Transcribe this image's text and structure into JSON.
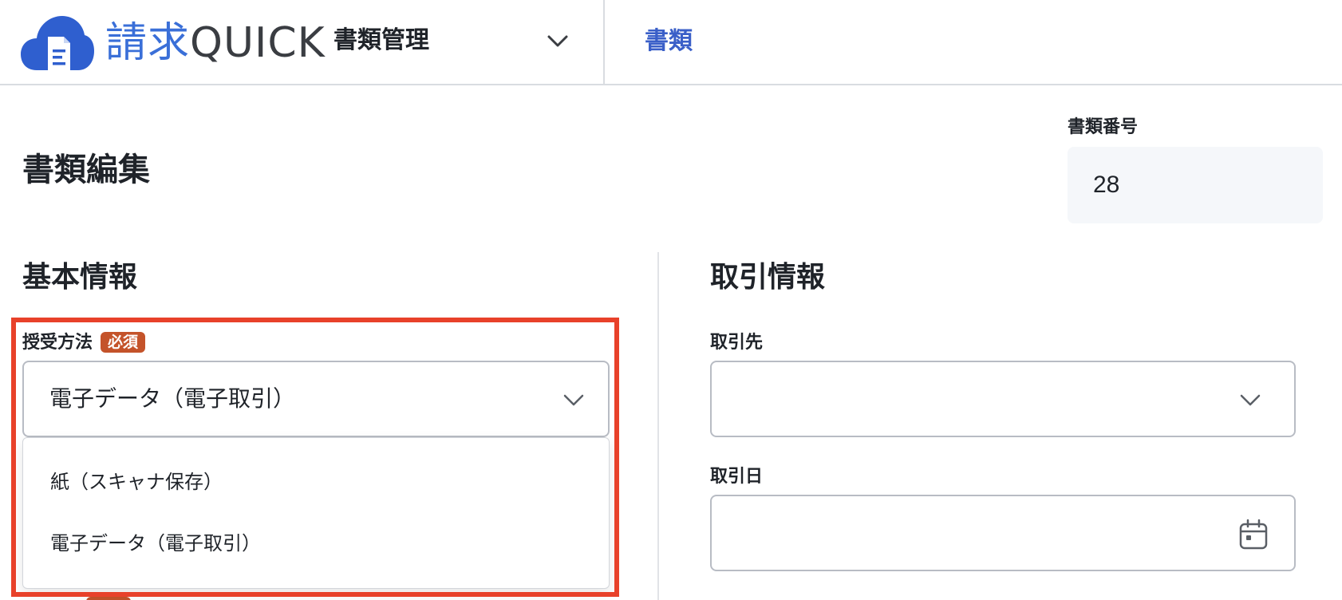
{
  "header": {
    "logo_kanji": "請求",
    "logo_latin": "QUICK",
    "module_label": "書類管理",
    "nav_link": "書類"
  },
  "page": {
    "title": "書類編集",
    "doc_number_label": "書類番号",
    "doc_number_value": "28"
  },
  "basic_info": {
    "title": "基本情報",
    "receipt_method": {
      "label": "授受方法",
      "required_badge": "必須",
      "selected": "電子データ（電子取引）",
      "options": [
        "紙（スキャナ保存）",
        "電子データ（電子取引）"
      ]
    }
  },
  "trade_info": {
    "title": "取引情報",
    "partner": {
      "label": "取引先",
      "value": ""
    },
    "date": {
      "label": "取引日",
      "value": ""
    }
  },
  "colors": {
    "brand_blue": "#3a6fd8",
    "required_badge": "#c4532a",
    "highlight": "#e8412a"
  },
  "icons": {
    "logo": "cloud-document-icon",
    "module_chevron": "chevron-down-icon",
    "receipt_chevron": "chevron-down-icon",
    "partner_chevron": "chevron-down-icon",
    "date": "calendar-icon"
  }
}
